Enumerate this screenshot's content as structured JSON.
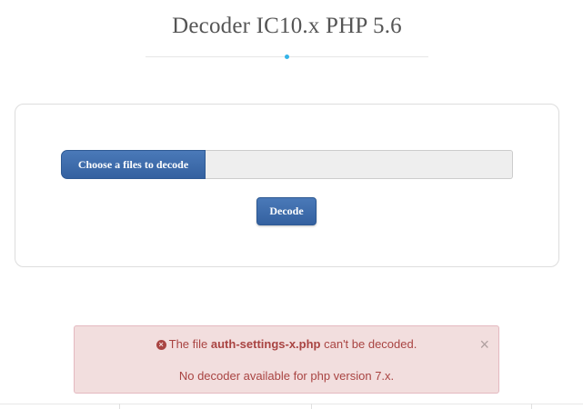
{
  "page": {
    "title": "Decoder IC10.x PHP 5.6"
  },
  "upload": {
    "choose_label": "Choose a files to decode",
    "file_display": "",
    "decode_label": "Decode"
  },
  "alert": {
    "prefix": "The file ",
    "filename": "auth-settings-x.php",
    "suffix": " can't be decoded.",
    "message": "No decoder available for php version 7.x.",
    "close_glyph": "×",
    "icon_glyph": "×"
  },
  "colors": {
    "accent_dot": "#35b4e8",
    "button_blue": "#3d6cab",
    "alert_background": "#f2dede",
    "alert_text": "#a94442"
  },
  "icons": {
    "error": "times-circle-icon",
    "close": "close-icon"
  }
}
